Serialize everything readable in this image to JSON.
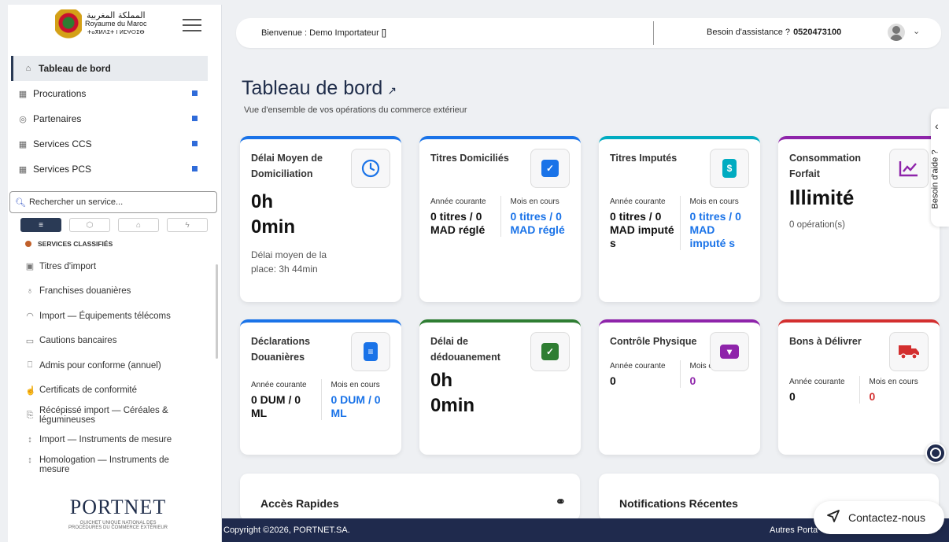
{
  "brand": {
    "line_ar": "المملكة المغربية",
    "line_fr": "Royaume du Maroc",
    "line_tz": "ⵜⴰⴳⵍⴷⵉⵜ ⵏ ⵍⵎⵖⵔⵉⴱ"
  },
  "nav": [
    {
      "label": "Tableau de bord",
      "icon": "home-icon"
    },
    {
      "label": "Procurations",
      "icon": "calendar-icon"
    },
    {
      "label": "Partenaires",
      "icon": "globe-icon"
    },
    {
      "label": "Services CCS",
      "icon": "calendar-icon"
    },
    {
      "label": "Services PCS",
      "icon": "calendar-icon"
    }
  ],
  "search": {
    "placeholder": "Rechercher un service..."
  },
  "services": {
    "title": "SERVICES CLASSIFIÉS",
    "items": [
      "Titres d'import",
      "Franchises douanières",
      "Import — Équipements télécoms",
      "Cautions bancaires",
      "Admis pour conforme (annuel)",
      "Certificats de conformité",
      "Récépissé import — Céréales & légumineuses",
      "Import — Instruments de mesure",
      "Homologation — Instruments de mesure"
    ]
  },
  "portnet": {
    "logo": "PORTNET",
    "sub": "GUICHET UNIQUE NATIONAL DES PROCÉDURES DU COMMERCE EXTÉRIEUR"
  },
  "topbar": {
    "welcome": "Bienvenue : Demo Importateur []",
    "help_label": "Besoin d'assistance ?",
    "phone": "0520473100"
  },
  "page": {
    "title": "Tableau de bord",
    "subtitle": "Vue d'ensemble de vos opérations du commerce extérieur"
  },
  "cards": {
    "delai_dom": {
      "title": "Délai Moyen de Domiciliation",
      "big1": "0h",
      "big2": "0min",
      "desc": "Délai moyen de la place: 3h 44min"
    },
    "titres_dom": {
      "title": "Titres Domiciliés",
      "l1": "Année courante",
      "v1": "0 titres / 0 MAD réglé",
      "l2": "Mois en cours",
      "v2": "0 titres / 0 MAD réglé"
    },
    "titres_imp": {
      "title": "Titres Imputés",
      "l1": "Année courante",
      "v1": "0 titres / 0 MAD imputé s",
      "l2": "Mois en cours",
      "v2": "0 titres / 0 MAD imputé s"
    },
    "conso": {
      "title": "Consommation Forfait",
      "big": "Illimité",
      "desc": "0 opération(s)"
    },
    "decl": {
      "title": "Déclarations Douanières",
      "l1": "Année courante",
      "v1": "0 DUM / 0 ML",
      "l2": "Mois en cours",
      "v2": "0 DUM / 0 ML"
    },
    "dedouan": {
      "title": "Délai de dédouanement",
      "big1": "0h",
      "big2": "0min"
    },
    "controle": {
      "title": "Contrôle Physique",
      "l1": "Année courante",
      "v1": "0",
      "l2": "Mois en cours",
      "v2": "0"
    },
    "bons": {
      "title": "Bons à Délivrer",
      "l1": "Année courante",
      "v1": "0",
      "l2": "Mois en cours",
      "v2": "0"
    }
  },
  "panels": {
    "acces": "Accès Rapides",
    "notif": "Notifications Récentes"
  },
  "footer": {
    "copyright": "Copyright ©2026, PORTNET.SA.",
    "other": "Autres Porta"
  },
  "contact": {
    "label": "Contactez-nous"
  },
  "help_side": {
    "label": "Besoin d'aide ?"
  },
  "colors": {
    "blue": "#1a73e8",
    "teal": "#00acc1",
    "purple": "#8e24aa",
    "green": "#2e7d32",
    "red": "#d32f2f",
    "navy": "#1f2a4d"
  }
}
